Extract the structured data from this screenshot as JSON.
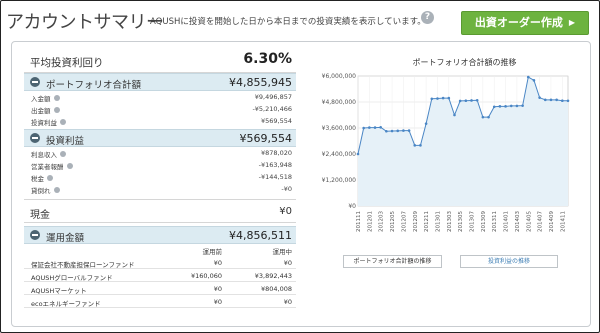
{
  "header": {
    "title": "アカウントサマリー",
    "description": "AQUSHに投資を開始した日から本日までの投資実績を表示しています。",
    "help_icon": "?",
    "order_button": "出資オーダー作成",
    "order_arrow": "▶"
  },
  "summary": {
    "yield_label": "平均投資利回り",
    "yield_value": "6.30%",
    "portfolio": {
      "label": "ポートフォリオ合計額",
      "value": "¥4,855,945",
      "items": [
        {
          "label": "入金額",
          "value": "¥9,496,857"
        },
        {
          "label": "出金額",
          "value": "-¥5,210,466"
        },
        {
          "label": "投資利益",
          "value": "¥569,554"
        }
      ]
    },
    "profit": {
      "label": "投資利益",
      "value": "¥569,554",
      "items": [
        {
          "label": "利息収入",
          "value": "¥878,020"
        },
        {
          "label": "営業者報酬",
          "value": "-¥163,948"
        },
        {
          "label": "税金",
          "value": "-¥144,518"
        },
        {
          "label": "貸倒れ",
          "value": "-¥0"
        }
      ]
    },
    "cash": {
      "label": "現金",
      "value": "¥0"
    },
    "operating": {
      "label": "運用金額",
      "value": "¥4,856,511",
      "col_before": "運用前",
      "col_during": "運用中",
      "funds": [
        {
          "name": "保証会社不動産担保ローンファンド",
          "before": "¥0",
          "during": "¥0"
        },
        {
          "name": "AQUSHグローバルファンド",
          "before": "¥160,060",
          "during": "¥3,892,443"
        },
        {
          "name": "AQUSHマーケット",
          "before": "¥0",
          "during": "¥804,008"
        },
        {
          "name": "ecoエネルギーファンド",
          "before": "¥0",
          "during": "¥0"
        }
      ]
    }
  },
  "chart": {
    "buttons": {
      "portfolio": "ポートフォリオ合計額の推移",
      "profit": "投資利益の推移"
    }
  },
  "chart_data": {
    "type": "area",
    "title": "ポートフォリオ合計額の推移",
    "xlabel": "",
    "ylabel": "",
    "ylim": [
      0,
      6000000
    ],
    "yticks": [
      0,
      1200000,
      2400000,
      3600000,
      4800000,
      6000000
    ],
    "ytick_labels": [
      "¥0",
      "¥1,200,000",
      "¥2,400,000",
      "¥3,600,000",
      "¥4,800,000",
      "¥6,000,000"
    ],
    "x": [
      "201111",
      "201112",
      "201201",
      "201202",
      "201203",
      "201204",
      "201205",
      "201206",
      "201207",
      "201208",
      "201209",
      "201210",
      "201211",
      "201212",
      "201301",
      "201302",
      "201303",
      "201304",
      "201305",
      "201306",
      "201307",
      "201308",
      "201309",
      "201310",
      "201311",
      "201312",
      "201401",
      "201402",
      "201403",
      "201404",
      "201405",
      "201406",
      "201407",
      "201408",
      "201409",
      "201410",
      "201411",
      "201412"
    ],
    "x_tick_labels": [
      "201111",
      "201201",
      "201203",
      "201205",
      "201207",
      "201209",
      "201211",
      "201301",
      "201303",
      "201305",
      "201307",
      "201309",
      "201311",
      "201401",
      "201403",
      "201405",
      "201407",
      "201409",
      "201411"
    ],
    "values": [
      2400000,
      3600000,
      3620000,
      3620000,
      3630000,
      3450000,
      3460000,
      3470000,
      3480000,
      3480000,
      2800000,
      2800000,
      3800000,
      4950000,
      4960000,
      4980000,
      4980000,
      4200000,
      4850000,
      4860000,
      4870000,
      4880000,
      4100000,
      4100000,
      4580000,
      4600000,
      4600000,
      4620000,
      4620000,
      4630000,
      5950000,
      5800000,
      5000000,
      4900000,
      4900000,
      4900000,
      4860000,
      4856000
    ],
    "color": "#4a86c5",
    "fill": "#e6f1f8",
    "grid": true
  }
}
